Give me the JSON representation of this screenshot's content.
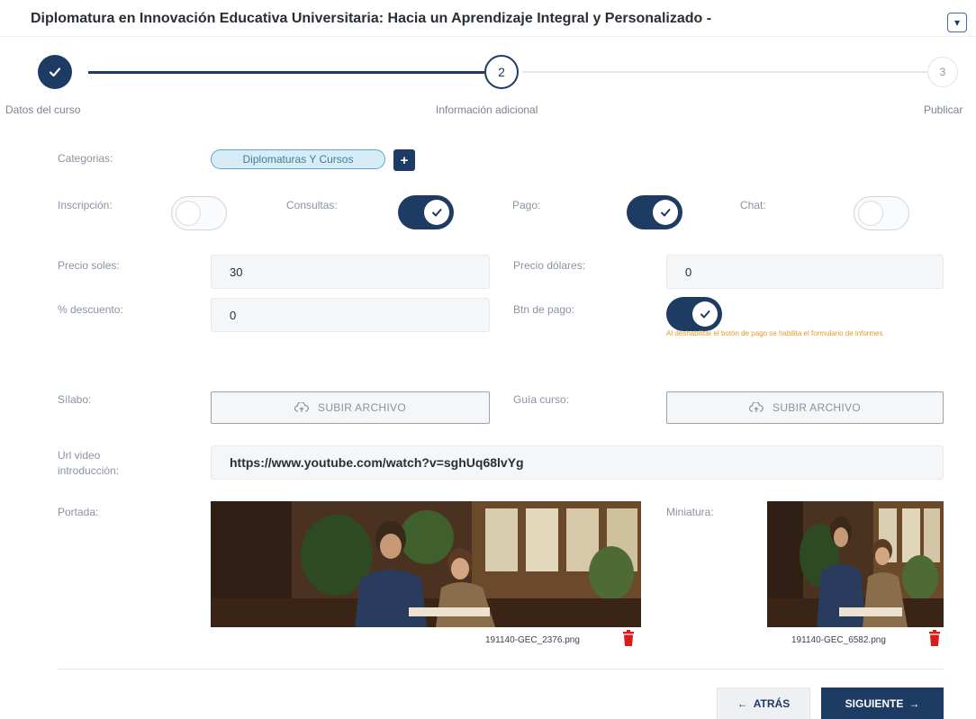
{
  "header": {
    "title": "Diplomatura en Innovación Educativa Universitaria: Hacia un Aprendizaje Integral y Personalizado -",
    "collapse_icon": "square-dot-icon"
  },
  "stepper": {
    "steps": [
      {
        "number": "",
        "label": "Datos del curso",
        "state": "done",
        "icon": "check-icon"
      },
      {
        "number": "2",
        "label": "Información adicional",
        "state": "active"
      },
      {
        "number": "3",
        "label": "Publicar",
        "state": "pending"
      }
    ]
  },
  "form": {
    "categorias_label": "Categorias:",
    "categoria_chip": "Diplomaturas Y Cursos",
    "add_category": "+",
    "toggles": [
      {
        "label": "Inscripción:",
        "on": false
      },
      {
        "label": "Consultas:",
        "on": true
      },
      {
        "label": "Pago:",
        "on": true
      },
      {
        "label": "Chat:",
        "on": false
      }
    ],
    "precio_soles_label": "Precio soles:",
    "precio_soles": "30",
    "precio_dolares_label": "Precio dólares:",
    "precio_dolares": "0",
    "descuento_label": "% descuento:",
    "descuento": "0",
    "btn_pago_label": "Btn de pago:",
    "btn_pago_on": true,
    "btn_pago_note": "Al deshabilitar el botón de pago se habilita el formulario de informes",
    "silabo_label": "Sílabo:",
    "guia_label": "Guía curso:",
    "upload_label": "SUBIR ARCHIVO",
    "url_label_1": "Url video",
    "url_label_2": "introducción:",
    "url_value": "https://www.youtube.com/watch?v=sghUq68lvYg",
    "portada_label": "Portada:",
    "portada_file": "191140-GEC_2376.png",
    "miniatura_label": "Miniatura:",
    "miniatura_file": "191140-GEC_6582.png"
  },
  "actions": {
    "back": "ATRÁS",
    "next": "SIGUIENTE"
  },
  "colors": {
    "primary": "#1d3b63",
    "chip_bg": "#d8ecf6",
    "warning": "#e69b22",
    "delete": "#d81b1b"
  }
}
